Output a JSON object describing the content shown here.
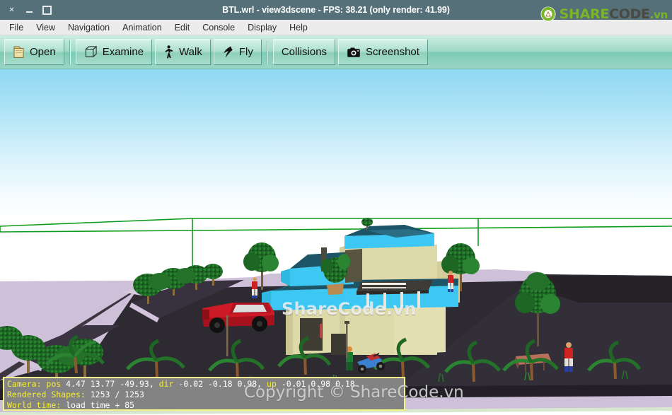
{
  "window": {
    "title": "BTL.wrl - view3dscene - FPS: 38.21 (only render: 41.99)",
    "buttons": {
      "close": "close-window",
      "minimize": "minimize-window",
      "maximize": "maximize-window"
    }
  },
  "logo": {
    "icon": "recycle-arrows-icon",
    "part1": "SHARE",
    "part2": "CODE",
    "part3": ".vn",
    "color_green": "#7ab526",
    "color_dark": "#4a4a42"
  },
  "menubar": {
    "items": [
      {
        "label": "File"
      },
      {
        "label": "View"
      },
      {
        "label": "Navigation"
      },
      {
        "label": "Animation"
      },
      {
        "label": "Edit"
      },
      {
        "label": "Console"
      },
      {
        "label": "Display"
      },
      {
        "label": "Help"
      }
    ]
  },
  "toolbar": {
    "open_label": "Open",
    "examine_label": "Examine",
    "walk_label": "Walk",
    "fly_label": "Fly",
    "collisions_label": "Collisions",
    "screenshot_label": "Screenshot",
    "icons": {
      "open": "folder-icon",
      "examine": "cube-icon",
      "walk": "walking-person-icon",
      "fly": "bird-wing-icon",
      "screenshot": "camera-icon"
    }
  },
  "status": {
    "camera_key": "Camera:",
    "camera_pos_key": "pos",
    "camera_pos_value": "4.47 13.77 -49.93,",
    "camera_dir_key": "dir",
    "camera_dir_value": "-0.02 -0.18 0.98,",
    "camera_up_key": "up",
    "camera_up_value": "-0.01 0.98 0.18",
    "shapes_key": "Rendered Shapes:",
    "shapes_value": "1253 / 1253",
    "worldtime_key": "World time:",
    "worldtime_value": "load time + 85",
    "border_color": "#f2f58a",
    "background_color": "#838383",
    "key_color": "#f6f02c"
  },
  "watermarks": {
    "center": "ShareCode.vn",
    "copyright": "Copyright © ShareCode.vn"
  },
  "scene": {
    "description": "3D architectural VRML scene: two-storey beige house with cyan roofs, red pickup truck, trees, palm plants, human figures, dark asphalt ground and lavender terrain plane, green wireframe bounding lines",
    "colors": {
      "sky_top": "#8ed8f2",
      "sky_bottom": "#ffffff",
      "ground_asphalt": "#322e36",
      "ground_lavender": "#cfc0da",
      "building_wall": "#ded9a8",
      "roof_cyan": "#37c6f0",
      "roof_shadow": "#1d4f63",
      "truck_red": "#cc1a26",
      "wireframe_green": "#0f9b1b",
      "foliage_dark": "#1c5d22",
      "foliage_mid": "#2f8a35"
    }
  }
}
